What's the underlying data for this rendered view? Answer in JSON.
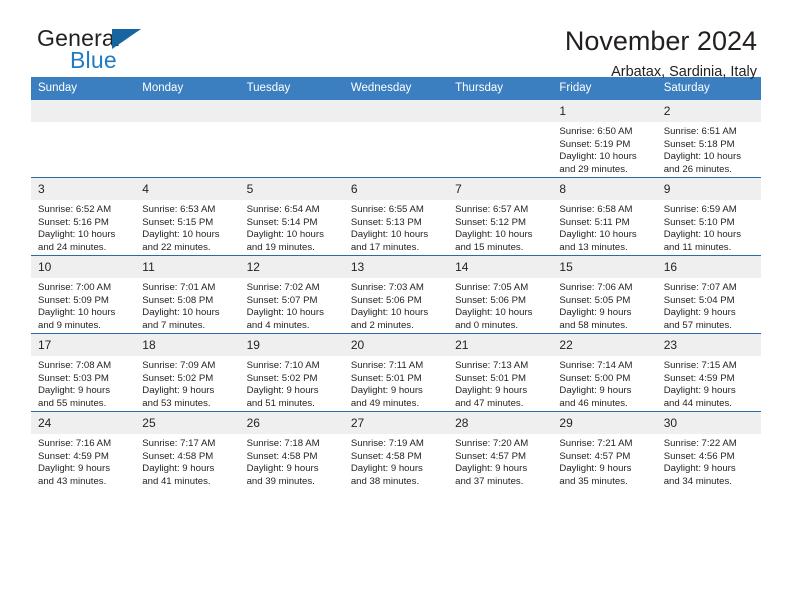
{
  "brand": {
    "name_part1": "General",
    "name_part2": "Blue",
    "triangle_color": "#16659e",
    "blue_color": "#1f7cc4"
  },
  "header": {
    "title": "November 2024",
    "subtitle": "Arbatax, Sardinia, Italy"
  },
  "theme": {
    "header_blue": "#3c7fc0",
    "grid_line_blue": "#2b6ca8",
    "daynum_band": "#efefef"
  },
  "weekday_headers": [
    "Sunday",
    "Monday",
    "Tuesday",
    "Wednesday",
    "Thursday",
    "Friday",
    "Saturday"
  ],
  "weeks": [
    [
      {
        "day": "",
        "sunrise": "",
        "sunset": "",
        "daylight_line1": "",
        "daylight_line2": ""
      },
      {
        "day": "",
        "sunrise": "",
        "sunset": "",
        "daylight_line1": "",
        "daylight_line2": ""
      },
      {
        "day": "",
        "sunrise": "",
        "sunset": "",
        "daylight_line1": "",
        "daylight_line2": ""
      },
      {
        "day": "",
        "sunrise": "",
        "sunset": "",
        "daylight_line1": "",
        "daylight_line2": ""
      },
      {
        "day": "",
        "sunrise": "",
        "sunset": "",
        "daylight_line1": "",
        "daylight_line2": ""
      },
      {
        "day": "1",
        "sunrise": "Sunrise: 6:50 AM",
        "sunset": "Sunset: 5:19 PM",
        "daylight_line1": "Daylight: 10 hours",
        "daylight_line2": "and 29 minutes."
      },
      {
        "day": "2",
        "sunrise": "Sunrise: 6:51 AM",
        "sunset": "Sunset: 5:18 PM",
        "daylight_line1": "Daylight: 10 hours",
        "daylight_line2": "and 26 minutes."
      }
    ],
    [
      {
        "day": "3",
        "sunrise": "Sunrise: 6:52 AM",
        "sunset": "Sunset: 5:16 PM",
        "daylight_line1": "Daylight: 10 hours",
        "daylight_line2": "and 24 minutes."
      },
      {
        "day": "4",
        "sunrise": "Sunrise: 6:53 AM",
        "sunset": "Sunset: 5:15 PM",
        "daylight_line1": "Daylight: 10 hours",
        "daylight_line2": "and 22 minutes."
      },
      {
        "day": "5",
        "sunrise": "Sunrise: 6:54 AM",
        "sunset": "Sunset: 5:14 PM",
        "daylight_line1": "Daylight: 10 hours",
        "daylight_line2": "and 19 minutes."
      },
      {
        "day": "6",
        "sunrise": "Sunrise: 6:55 AM",
        "sunset": "Sunset: 5:13 PM",
        "daylight_line1": "Daylight: 10 hours",
        "daylight_line2": "and 17 minutes."
      },
      {
        "day": "7",
        "sunrise": "Sunrise: 6:57 AM",
        "sunset": "Sunset: 5:12 PM",
        "daylight_line1": "Daylight: 10 hours",
        "daylight_line2": "and 15 minutes."
      },
      {
        "day": "8",
        "sunrise": "Sunrise: 6:58 AM",
        "sunset": "Sunset: 5:11 PM",
        "daylight_line1": "Daylight: 10 hours",
        "daylight_line2": "and 13 minutes."
      },
      {
        "day": "9",
        "sunrise": "Sunrise: 6:59 AM",
        "sunset": "Sunset: 5:10 PM",
        "daylight_line1": "Daylight: 10 hours",
        "daylight_line2": "and 11 minutes."
      }
    ],
    [
      {
        "day": "10",
        "sunrise": "Sunrise: 7:00 AM",
        "sunset": "Sunset: 5:09 PM",
        "daylight_line1": "Daylight: 10 hours",
        "daylight_line2": "and 9 minutes."
      },
      {
        "day": "11",
        "sunrise": "Sunrise: 7:01 AM",
        "sunset": "Sunset: 5:08 PM",
        "daylight_line1": "Daylight: 10 hours",
        "daylight_line2": "and 7 minutes."
      },
      {
        "day": "12",
        "sunrise": "Sunrise: 7:02 AM",
        "sunset": "Sunset: 5:07 PM",
        "daylight_line1": "Daylight: 10 hours",
        "daylight_line2": "and 4 minutes."
      },
      {
        "day": "13",
        "sunrise": "Sunrise: 7:03 AM",
        "sunset": "Sunset: 5:06 PM",
        "daylight_line1": "Daylight: 10 hours",
        "daylight_line2": "and 2 minutes."
      },
      {
        "day": "14",
        "sunrise": "Sunrise: 7:05 AM",
        "sunset": "Sunset: 5:06 PM",
        "daylight_line1": "Daylight: 10 hours",
        "daylight_line2": "and 0 minutes."
      },
      {
        "day": "15",
        "sunrise": "Sunrise: 7:06 AM",
        "sunset": "Sunset: 5:05 PM",
        "daylight_line1": "Daylight: 9 hours",
        "daylight_line2": "and 58 minutes."
      },
      {
        "day": "16",
        "sunrise": "Sunrise: 7:07 AM",
        "sunset": "Sunset: 5:04 PM",
        "daylight_line1": "Daylight: 9 hours",
        "daylight_line2": "and 57 minutes."
      }
    ],
    [
      {
        "day": "17",
        "sunrise": "Sunrise: 7:08 AM",
        "sunset": "Sunset: 5:03 PM",
        "daylight_line1": "Daylight: 9 hours",
        "daylight_line2": "and 55 minutes."
      },
      {
        "day": "18",
        "sunrise": "Sunrise: 7:09 AM",
        "sunset": "Sunset: 5:02 PM",
        "daylight_line1": "Daylight: 9 hours",
        "daylight_line2": "and 53 minutes."
      },
      {
        "day": "19",
        "sunrise": "Sunrise: 7:10 AM",
        "sunset": "Sunset: 5:02 PM",
        "daylight_line1": "Daylight: 9 hours",
        "daylight_line2": "and 51 minutes."
      },
      {
        "day": "20",
        "sunrise": "Sunrise: 7:11 AM",
        "sunset": "Sunset: 5:01 PM",
        "daylight_line1": "Daylight: 9 hours",
        "daylight_line2": "and 49 minutes."
      },
      {
        "day": "21",
        "sunrise": "Sunrise: 7:13 AM",
        "sunset": "Sunset: 5:01 PM",
        "daylight_line1": "Daylight: 9 hours",
        "daylight_line2": "and 47 minutes."
      },
      {
        "day": "22",
        "sunrise": "Sunrise: 7:14 AM",
        "sunset": "Sunset: 5:00 PM",
        "daylight_line1": "Daylight: 9 hours",
        "daylight_line2": "and 46 minutes."
      },
      {
        "day": "23",
        "sunrise": "Sunrise: 7:15 AM",
        "sunset": "Sunset: 4:59 PM",
        "daylight_line1": "Daylight: 9 hours",
        "daylight_line2": "and 44 minutes."
      }
    ],
    [
      {
        "day": "24",
        "sunrise": "Sunrise: 7:16 AM",
        "sunset": "Sunset: 4:59 PM",
        "daylight_line1": "Daylight: 9 hours",
        "daylight_line2": "and 43 minutes."
      },
      {
        "day": "25",
        "sunrise": "Sunrise: 7:17 AM",
        "sunset": "Sunset: 4:58 PM",
        "daylight_line1": "Daylight: 9 hours",
        "daylight_line2": "and 41 minutes."
      },
      {
        "day": "26",
        "sunrise": "Sunrise: 7:18 AM",
        "sunset": "Sunset: 4:58 PM",
        "daylight_line1": "Daylight: 9 hours",
        "daylight_line2": "and 39 minutes."
      },
      {
        "day": "27",
        "sunrise": "Sunrise: 7:19 AM",
        "sunset": "Sunset: 4:58 PM",
        "daylight_line1": "Daylight: 9 hours",
        "daylight_line2": "and 38 minutes."
      },
      {
        "day": "28",
        "sunrise": "Sunrise: 7:20 AM",
        "sunset": "Sunset: 4:57 PM",
        "daylight_line1": "Daylight: 9 hours",
        "daylight_line2": "and 37 minutes."
      },
      {
        "day": "29",
        "sunrise": "Sunrise: 7:21 AM",
        "sunset": "Sunset: 4:57 PM",
        "daylight_line1": "Daylight: 9 hours",
        "daylight_line2": "and 35 minutes."
      },
      {
        "day": "30",
        "sunrise": "Sunrise: 7:22 AM",
        "sunset": "Sunset: 4:56 PM",
        "daylight_line1": "Daylight: 9 hours",
        "daylight_line2": "and 34 minutes."
      }
    ]
  ]
}
